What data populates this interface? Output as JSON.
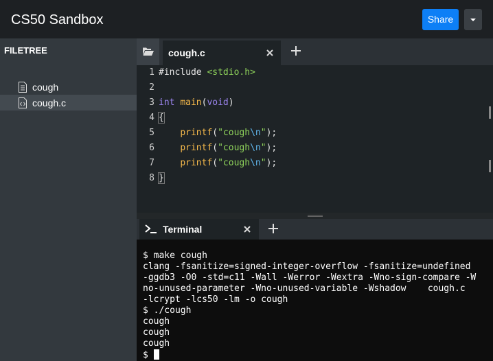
{
  "header": {
    "title": "CS50 Sandbox",
    "share_label": "Share",
    "dropdown_icon": "caret-down-icon"
  },
  "sidebar": {
    "title": "FILETREE",
    "items": [
      {
        "label": "cough",
        "icon": "text-file-icon",
        "selected": false
      },
      {
        "label": "cough.c",
        "icon": "code-file-icon",
        "selected": true
      }
    ]
  },
  "editor": {
    "folder_icon": "folder-open-icon",
    "tab_label": "cough.c",
    "close_icon": "close-icon",
    "add_icon": "plus-icon",
    "line_numbers": [
      "1",
      "2",
      "3",
      "4",
      "5",
      "6",
      "7",
      "8"
    ],
    "code": {
      "line1_directive": "#include ",
      "line1_header": "<stdio.h>",
      "line3_type": "int",
      "line3_space": " ",
      "line3_func": "main",
      "line3_paren_open": "(",
      "line3_void": "void",
      "line3_paren_close": ")",
      "open_brace": "{",
      "close_brace": "}",
      "indent": "    ",
      "printf": "printf",
      "call_open": "(",
      "str_open": "\"cough",
      "escape": "\\n",
      "str_close": "\"",
      "call_close": ");"
    }
  },
  "terminal": {
    "tab_label": "Terminal",
    "tab_icon": "terminal-icon",
    "close_icon": "close-icon",
    "add_icon": "plus-icon",
    "lines": [
      "$ make cough",
      "clang -fsanitize=signed-integer-overflow -fsanitize=undefined",
      "-ggdb3 -O0 -std=c11 -Wall -Werror -Wextra -Wno-sign-compare -W",
      "no-unused-parameter -Wno-unused-variable -Wshadow    cough.c",
      "-lcrypt -lcs50 -lm -o cough",
      "$ ./cough",
      "cough",
      "cough",
      "cough"
    ],
    "prompt": "$ "
  },
  "colors": {
    "accent": "#0d7ff6",
    "keyword": "#9b84ee",
    "function": "#f5b94b",
    "string": "#8fd35b",
    "escape": "#5fb4e9"
  }
}
